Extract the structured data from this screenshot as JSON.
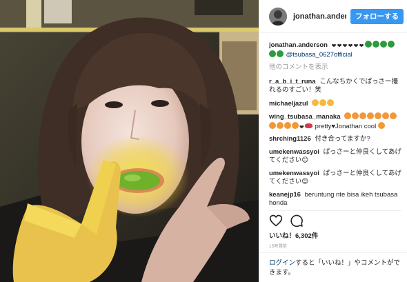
{
  "post": {
    "username": "jonathan.anderson",
    "header_username": "jonathan.andersoi",
    "follow_label": "フォローする"
  },
  "caption": {
    "username": "jonathan.anderson",
    "mention": "@tsubasa_0627official"
  },
  "load_more_label": "他のコメントを表示",
  "comments": [
    {
      "user": "r_a_b_i_t_runa",
      "text": "こんなちかくでぱっさー撮れるのすごい！笑"
    },
    {
      "user": "michaeljazul",
      "text": ""
    },
    {
      "user": "wing_tsubasa_manaka",
      "text_tail": "pretty♥Jonathan cool"
    },
    {
      "user": "shrching1126",
      "text": "付き合ってますか?"
    },
    {
      "user": "umekenwassyoi",
      "text": "ぱっさーと仲良くしてあげてください😊"
    },
    {
      "user": "umekenwassyoi",
      "text": "ぱっさーと仲良くしてあげてください😊"
    },
    {
      "user": "keanejp16",
      "text": "beruntung nte bisa ikeh tsubasa honda"
    }
  ],
  "likes_label": "いいね！6,302件",
  "timestamp": "15時間前",
  "footer": {
    "login_label": "ログイン",
    "rest_text": "すると「いいね！」やコメントができます。"
  },
  "colors": {
    "follow_button": "#3897f0",
    "link": "#003569",
    "muted": "#999999"
  },
  "icons": [
    "heart-icon",
    "comment-icon"
  ]
}
